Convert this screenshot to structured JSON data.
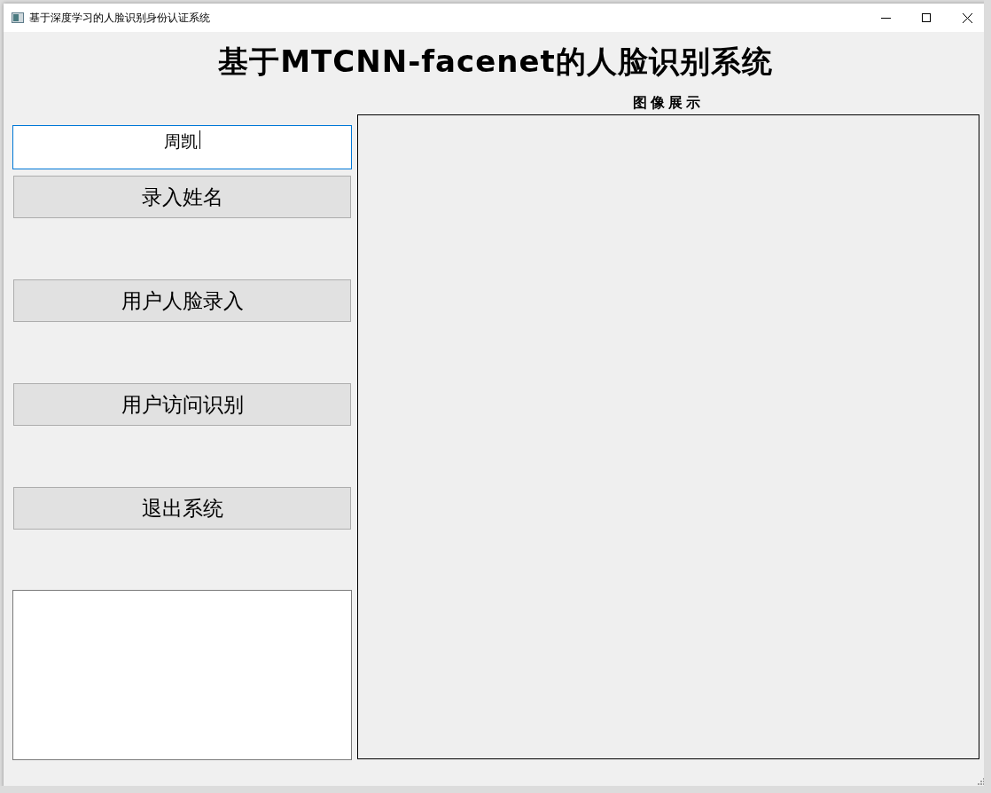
{
  "window": {
    "title": "基于深度学习的人脸识别身份认证系统"
  },
  "heading": "基于MTCNN-facenet的人脸识别系统",
  "name_field": {
    "value": "周凯",
    "focused": true
  },
  "buttons": [
    {
      "label": "录入姓名"
    },
    {
      "label": "用户人脸录入"
    },
    {
      "label": "用户访问识别"
    },
    {
      "label": "退出系统"
    }
  ],
  "image_panel": {
    "label": "图像展示"
  }
}
